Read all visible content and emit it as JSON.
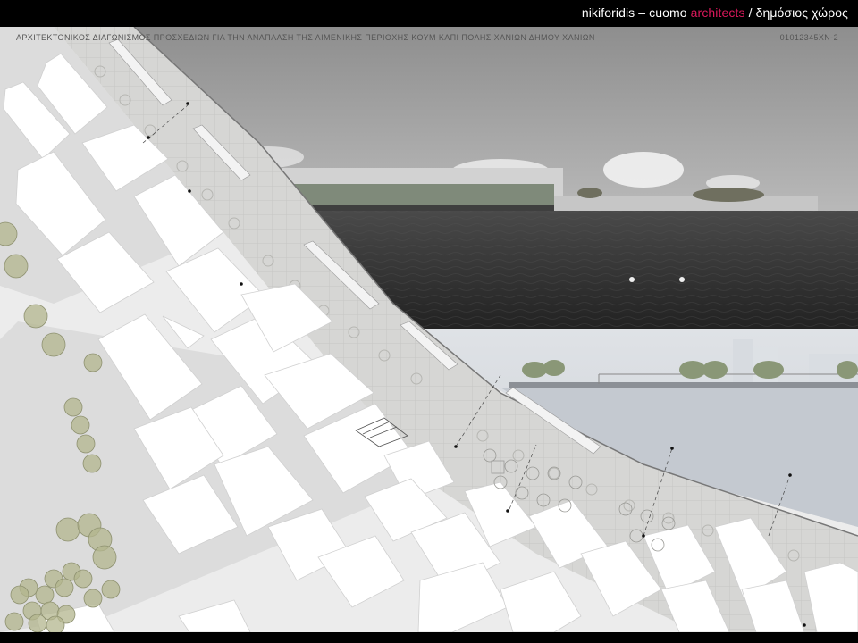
{
  "header": {
    "firm_name": "nikiforidis – cuomo",
    "firm_highlight": "architects",
    "separator": "/",
    "category": "δημόσιος χώρος"
  },
  "board": {
    "title": "ΑΡΧΙΤΕΚΤΟΝΙΚΟΣ ΔΙΑΓΩΝΙΣΜΟΣ ΠΡΟΣΧΕΔΙΩΝ ΓΙΑ ΤΗΝ ΑΝΑΠΛΑΣΗ ΤΗΣ ΛΙΜΕΝΙΚΗΣ ΠΕΡΙΟΧΗΣ ΚΟΥΜ ΚΑΠΙ ΠΟΛΗΣ ΧΑΝΙΩΝ ΔΗΜΟΥ ΧΑΝΙΩΝ",
    "code": "01012345XN-2"
  },
  "colors": {
    "accent": "#d8185a",
    "paving": "#d3d3d1",
    "blocks": "#ffffff",
    "sea": "#3a3a3a",
    "section_water": "#c4c9d0",
    "tree": "#a9ae88"
  }
}
